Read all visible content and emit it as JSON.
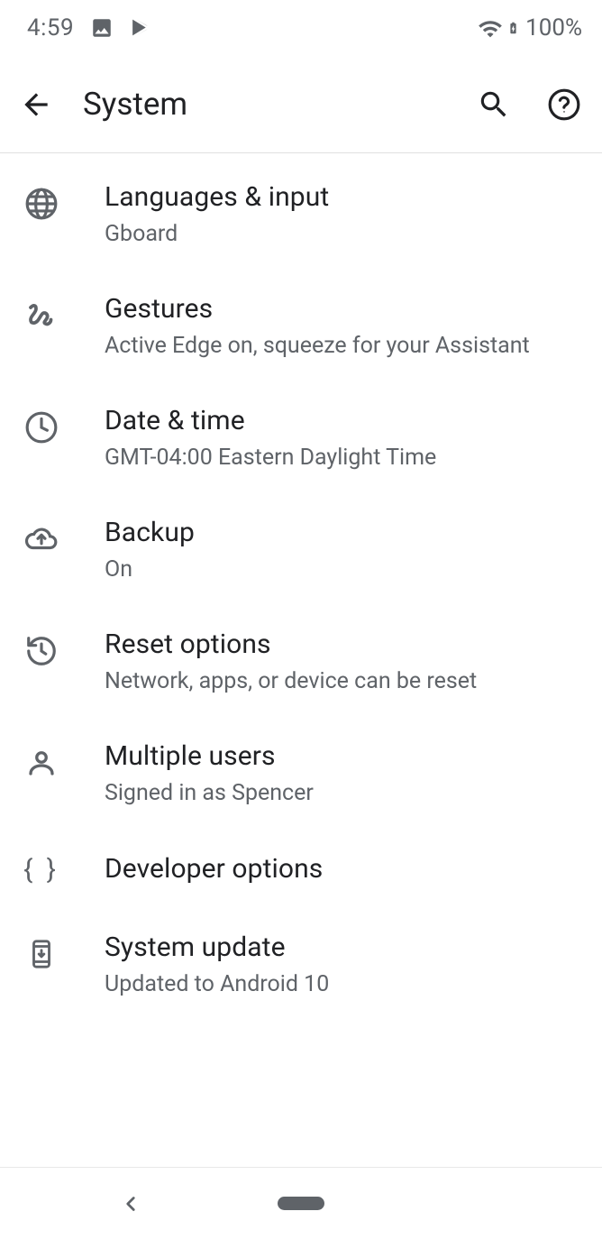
{
  "statusBar": {
    "time": "4:59",
    "battery": "100%"
  },
  "appBar": {
    "title": "System"
  },
  "items": [
    {
      "icon": "globe",
      "title": "Languages & input",
      "sub": "Gboard"
    },
    {
      "icon": "gesture",
      "title": "Gestures",
      "sub": "Active Edge on, squeeze for your Assistant"
    },
    {
      "icon": "clock",
      "title": "Date & time",
      "sub": "GMT-04:00 Eastern Daylight Time"
    },
    {
      "icon": "cloud-up",
      "title": "Backup",
      "sub": "On"
    },
    {
      "icon": "restore",
      "title": "Reset options",
      "sub": "Network, apps, or device can be reset"
    },
    {
      "icon": "person",
      "title": "Multiple users",
      "sub": "Signed in as Spencer"
    },
    {
      "icon": "braces",
      "title": "Developer options",
      "sub": ""
    },
    {
      "icon": "phone-down",
      "title": "System update",
      "sub": "Updated to Android 10"
    }
  ]
}
